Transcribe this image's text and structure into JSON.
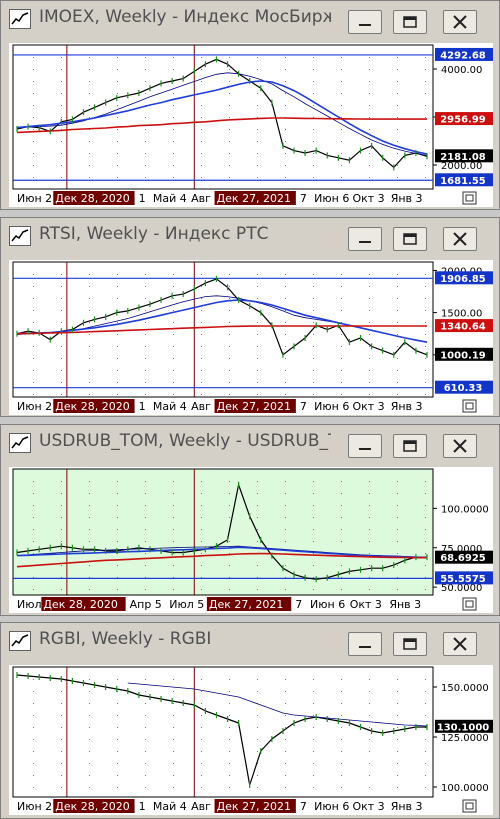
{
  "windows": [
    {
      "title": "IMOEX, Weekly - Индекс МосБиржи",
      "yticks": [
        "4000.00",
        "3000.00",
        "2000.00"
      ],
      "badges": [
        {
          "text": "4292.68",
          "kind": "blue"
        },
        {
          "text": "2956.99",
          "kind": "red"
        },
        {
          "text": "2181.08",
          "kind": "dark"
        },
        {
          "text": "1681.55",
          "kind": "blue"
        }
      ],
      "xlabels": [
        "Июн 2",
        "Дек 28, 2020",
        "1",
        "Май 4",
        "Авг",
        "Дек 27, 2021",
        "7",
        "Июн 6",
        "Окт 3",
        "Янв 3"
      ]
    },
    {
      "title": "RTSI, Weekly - Индекс РТС",
      "yticks": [
        "2000.00",
        "1500.00",
        "1000.00"
      ],
      "badges": [
        {
          "text": "1906.85",
          "kind": "blue"
        },
        {
          "text": "1340.64",
          "kind": "red"
        },
        {
          "text": "1000.19",
          "kind": "dark"
        },
        {
          "text": "610.33",
          "kind": "blue"
        }
      ],
      "xlabels": [
        "Июн 2",
        "Дек 28, 2020",
        "1",
        "Май 4",
        "Авг",
        "Дек 27, 2021",
        "7",
        "Июн 6",
        "Окт 3",
        "Янв 3"
      ]
    },
    {
      "title": "USDRUB_TOM, Weekly - USDRUB_T...",
      "yticks": [
        "100.0000",
        "75.0000",
        "50.0000"
      ],
      "badges": [
        {
          "text": "68.6925",
          "kind": "dark"
        },
        {
          "text": "55.5575",
          "kind": "blue"
        }
      ],
      "xlabels": [
        "Июл",
        "Дек 28, 2020",
        "Апр 5",
        "Июл 5",
        "Дек 27, 2021",
        "7",
        "Июн 6",
        "Окт 3",
        "Янв 3"
      ]
    },
    {
      "title": "RGBI, Weekly - RGBI",
      "yticks": [
        "150.0000",
        "125.0000",
        "100.0000"
      ],
      "badges": [
        {
          "text": "130.1000",
          "kind": "dark"
        }
      ],
      "xlabels": [
        "Июн 2",
        "Дек 28, 2020",
        "1",
        "Май 4",
        "Авг",
        "Дек 27, 2021",
        "7",
        "Июн 6",
        "Окт 3",
        "Янв 3"
      ]
    }
  ],
  "colors": {
    "price": "#000000",
    "ma_fast": "#000080",
    "ma_slow": "#1e3cd8",
    "ma_long": "#cc1010",
    "level": "#1e3cd8",
    "badge_blue": "#1436c8",
    "badge_red": "#cc1010",
    "badge_dark": "#000000",
    "date_highlight": "#6e0000",
    "vline": "#800000",
    "bg_normal": "#ffffff",
    "bg_usd": "#ddfadd"
  },
  "chart_data": [
    {
      "type": "line",
      "title": "IMOEX, Weekly - Индекс МосБиржи",
      "ylim": [
        1500,
        4500
      ],
      "x_ticks": [
        "Июн 2",
        "Дек 28, 2020",
        "1",
        "Май 4",
        "Авг",
        "Дек 27, 2021",
        "7",
        "Июн 6",
        "Окт 3",
        "Янв 3"
      ],
      "x": [
        0,
        4,
        8,
        12,
        16,
        20,
        24,
        28,
        32,
        36,
        40,
        44,
        48,
        52,
        56,
        60,
        64,
        68,
        72,
        76,
        80,
        84,
        88,
        92,
        96,
        100,
        104,
        108,
        112,
        116,
        120,
        124,
        128,
        132,
        136,
        140,
        144,
        148
      ],
      "series": [
        {
          "name": "",
          "values": [
            2750,
            2800,
            2780,
            2700,
            2900,
            2950,
            3100,
            3200,
            3300,
            3400,
            3450,
            3500,
            3600,
            3700,
            3750,
            3800,
            3950,
            4100,
            4200,
            4100,
            3900,
            3750,
            3600,
            3300,
            2400,
            2300,
            2250,
            2300,
            2200,
            2150,
            2100,
            2300,
            2400,
            2150,
            1950,
            2200,
            2250,
            2181
          ]
        },
        {
          "name": "",
          "values": [
            2780,
            2790,
            2800,
            2810,
            2830,
            2870,
            2920,
            2990,
            3060,
            3150,
            3240,
            3330,
            3420,
            3500,
            3580,
            3660,
            3740,
            3820,
            3890,
            3920,
            3900,
            3850,
            3780,
            3690,
            3550,
            3420,
            3280,
            3150,
            3020,
            2890,
            2760,
            2640,
            2520,
            2430,
            2350,
            2290,
            2240,
            2200
          ]
        },
        {
          "name": "",
          "values": [
            2780,
            2800,
            2820,
            2840,
            2870,
            2900,
            2940,
            2980,
            3030,
            3080,
            3130,
            3190,
            3250,
            3300,
            3360,
            3410,
            3460,
            3510,
            3560,
            3620,
            3680,
            3730,
            3750,
            3730,
            3650,
            3550,
            3420,
            3280,
            3140,
            3000,
            2860,
            2730,
            2610,
            2500,
            2410,
            2340,
            2280,
            2230
          ]
        },
        {
          "name": "",
          "values": [
            2680,
            2690,
            2700,
            2710,
            2720,
            2740,
            2750,
            2760,
            2770,
            2790,
            2800,
            2820,
            2830,
            2840,
            2860,
            2870,
            2890,
            2900,
            2920,
            2940,
            2950,
            2960,
            2970,
            2980,
            2980,
            2975,
            2970,
            2968,
            2965,
            2962,
            2960,
            2958,
            2957,
            2957,
            2957,
            2957,
            2957,
            2957
          ]
        }
      ],
      "levels": [
        4292.68,
        1681.55
      ],
      "markers": [
        "Дек 28, 2020",
        "Дек 27, 2021"
      ]
    },
    {
      "type": "line",
      "title": "RTSI, Weekly - Индекс РТС",
      "ylim": [
        500,
        2100
      ],
      "x_ticks": [
        "Июн 2",
        "Дек 28, 2020",
        "1",
        "Май 4",
        "Авг",
        "Дек 27, 2021",
        "7",
        "Июн 6",
        "Окт 3",
        "Янв 3"
      ],
      "x": [
        0,
        4,
        8,
        12,
        16,
        20,
        24,
        28,
        32,
        36,
        40,
        44,
        48,
        52,
        56,
        60,
        64,
        68,
        72,
        76,
        80,
        84,
        88,
        92,
        96,
        100,
        104,
        108,
        112,
        116,
        120,
        124,
        128,
        132,
        136,
        140,
        144,
        148
      ],
      "series": [
        {
          "name": "",
          "values": [
            1250,
            1280,
            1260,
            1180,
            1280,
            1300,
            1380,
            1420,
            1450,
            1500,
            1520,
            1560,
            1600,
            1650,
            1700,
            1720,
            1780,
            1850,
            1900,
            1800,
            1650,
            1580,
            1500,
            1350,
            1000,
            1100,
            1200,
            1350,
            1300,
            1350,
            1150,
            1200,
            1100,
            1050,
            1000,
            1150,
            1050,
            1000
          ]
        },
        {
          "name": "",
          "values": [
            1240,
            1250,
            1255,
            1260,
            1270,
            1290,
            1310,
            1340,
            1370,
            1400,
            1430,
            1470,
            1510,
            1550,
            1590,
            1630,
            1660,
            1690,
            1700,
            1690,
            1670,
            1640,
            1610,
            1570,
            1520,
            1470,
            1440,
            1420,
            1400,
            1380,
            1350,
            1320,
            1290,
            1260,
            1230,
            1200,
            1170,
            1150
          ]
        },
        {
          "name": "",
          "values": [
            1250,
            1255,
            1260,
            1265,
            1275,
            1290,
            1305,
            1320,
            1340,
            1360,
            1385,
            1410,
            1440,
            1470,
            1500,
            1530,
            1560,
            1590,
            1620,
            1640,
            1650,
            1640,
            1620,
            1590,
            1550,
            1510,
            1470,
            1440,
            1410,
            1380,
            1350,
            1320,
            1290,
            1260,
            1230,
            1200,
            1175,
            1150
          ]
        },
        {
          "name": "",
          "values": [
            1250,
            1252,
            1255,
            1258,
            1262,
            1266,
            1270,
            1275,
            1280,
            1285,
            1290,
            1295,
            1300,
            1305,
            1310,
            1315,
            1320,
            1325,
            1330,
            1335,
            1338,
            1340,
            1341,
            1341,
            1341,
            1341,
            1341,
            1341,
            1341,
            1341,
            1341,
            1341,
            1341,
            1341,
            1341,
            1341,
            1341,
            1341
          ]
        }
      ],
      "levels": [
        1906.85,
        610.33
      ],
      "markers": [
        "Дек 28, 2020",
        "Дек 27, 2021"
      ]
    },
    {
      "type": "line",
      "title": "USDRUB_TOM, Weekly - USDRUB_T...",
      "ylim": [
        45,
        125
      ],
      "x_ticks": [
        "Июл",
        "Дек 28, 2020",
        "Апр 5",
        "Июл 5",
        "Дек 27, 2021",
        "7",
        "Июн 6",
        "Окт 3",
        "Янв 3"
      ],
      "x": [
        0,
        4,
        8,
        12,
        16,
        20,
        24,
        28,
        32,
        36,
        40,
        44,
        48,
        52,
        56,
        60,
        64,
        68,
        72,
        76,
        80,
        84,
        88,
        92,
        96,
        100,
        104,
        108,
        112,
        116,
        120,
        124,
        128,
        132,
        136,
        140,
        144,
        148
      ],
      "series": [
        {
          "name": "",
          "values": [
            72,
            73,
            74,
            75,
            76,
            75,
            74,
            74,
            73,
            73,
            74,
            75,
            74,
            73,
            72,
            72,
            73,
            74,
            76,
            80,
            115,
            95,
            80,
            70,
            62,
            58,
            56,
            55,
            56,
            58,
            60,
            61,
            62,
            62,
            64,
            67,
            69,
            69
          ]
        },
        {
          "name": "",
          "values": [
            70,
            70.5,
            71,
            71.5,
            72,
            72.5,
            73,
            73.2,
            73.5,
            73.8,
            74,
            74.3,
            74.5,
            74.8,
            75,
            75.2,
            75.4,
            75.5,
            75.6,
            75.8,
            76,
            75.5,
            75,
            74.5,
            74,
            73.5,
            73,
            72.5,
            72,
            71.5,
            71,
            70.5,
            70.2,
            70,
            69.8,
            69.5,
            69.2,
            69
          ]
        },
        {
          "name": "",
          "values": [
            70,
            70.2,
            70.5,
            70.8,
            71,
            71.3,
            71.5,
            71.7,
            72,
            72.2,
            72.5,
            72.7,
            73,
            73.2,
            73.5,
            73.7,
            74,
            74.2,
            74.5,
            74.8,
            75.3,
            75,
            74.5,
            74,
            73.5,
            73,
            72.5,
            72,
            71.5,
            71,
            70.5,
            70,
            69.8,
            69.6,
            69.4,
            69.2,
            69,
            68.9
          ]
        },
        {
          "name": "",
          "values": [
            63,
            63.5,
            64,
            64.5,
            65,
            65.5,
            66,
            66.5,
            67,
            67.3,
            67.6,
            68,
            68.3,
            68.6,
            69,
            69.3,
            69.6,
            70,
            70.3,
            70.6,
            71,
            71.2,
            71.3,
            71.2,
            71,
            70.8,
            70.5,
            70.3,
            70,
            69.8,
            69.6,
            69.4,
            69.2,
            69,
            68.9,
            68.8,
            68.7,
            68.7
          ]
        }
      ],
      "levels": [
        55.5575
      ],
      "markers": [
        "Дек 28, 2020",
        "Дек 27, 2021"
      ]
    },
    {
      "type": "line",
      "title": "RGBI, Weekly - RGBI",
      "ylim": [
        95,
        160
      ],
      "x_ticks": [
        "Июн 2",
        "Дек 28, 2020",
        "1",
        "Май 4",
        "Авг",
        "Дек 27, 2021",
        "7",
        "Июн 6",
        "Окт 3",
        "Янв 3"
      ],
      "x": [
        0,
        4,
        8,
        12,
        16,
        20,
        24,
        28,
        32,
        36,
        40,
        44,
        48,
        52,
        56,
        60,
        64,
        68,
        72,
        76,
        80,
        84,
        88,
        92,
        96,
        100,
        104,
        108,
        112,
        116,
        120,
        124,
        128,
        132,
        136,
        140,
        144,
        148
      ],
      "series": [
        {
          "name": "",
          "values": [
            156,
            155.5,
            155,
            154.5,
            154,
            153,
            152,
            151,
            150,
            149,
            148,
            146,
            145,
            144,
            143,
            142,
            141,
            138,
            136,
            134,
            132,
            101,
            118,
            124,
            128,
            132,
            134,
            135,
            134,
            133,
            132,
            130,
            128,
            127,
            128,
            129,
            130,
            130
          ]
        },
        {
          "name": "",
          "values": [
            null,
            null,
            null,
            null,
            null,
            null,
            null,
            null,
            null,
            null,
            152,
            151.5,
            151,
            150.5,
            150,
            149.5,
            149,
            148,
            147,
            146,
            145,
            143,
            141,
            139,
            137,
            136,
            135.5,
            135,
            134.5,
            134,
            133.5,
            133,
            132.5,
            132,
            131.5,
            131,
            130.8,
            130.5
          ]
        },
        {
          "name": "",
          "values": [
            null,
            null,
            null,
            null,
            null,
            null,
            null,
            null,
            null,
            null,
            null,
            null,
            null,
            null,
            null,
            null,
            null,
            null,
            null,
            null,
            null,
            null,
            null,
            null,
            null,
            null,
            null,
            null,
            null,
            null,
            null,
            null,
            null,
            null,
            null,
            null,
            null,
            null
          ]
        },
        {
          "name": "",
          "values": [
            null,
            null,
            null,
            null,
            null,
            null,
            null,
            null,
            null,
            null,
            null,
            null,
            null,
            null,
            null,
            null,
            null,
            null,
            null,
            null,
            null,
            null,
            null,
            null,
            null,
            null,
            null,
            null,
            null,
            null,
            null,
            null,
            null,
            null,
            null,
            null,
            null,
            null
          ]
        }
      ],
      "levels": [],
      "markers": [
        "Дек 28, 2020",
        "Дек 27, 2021"
      ]
    }
  ]
}
